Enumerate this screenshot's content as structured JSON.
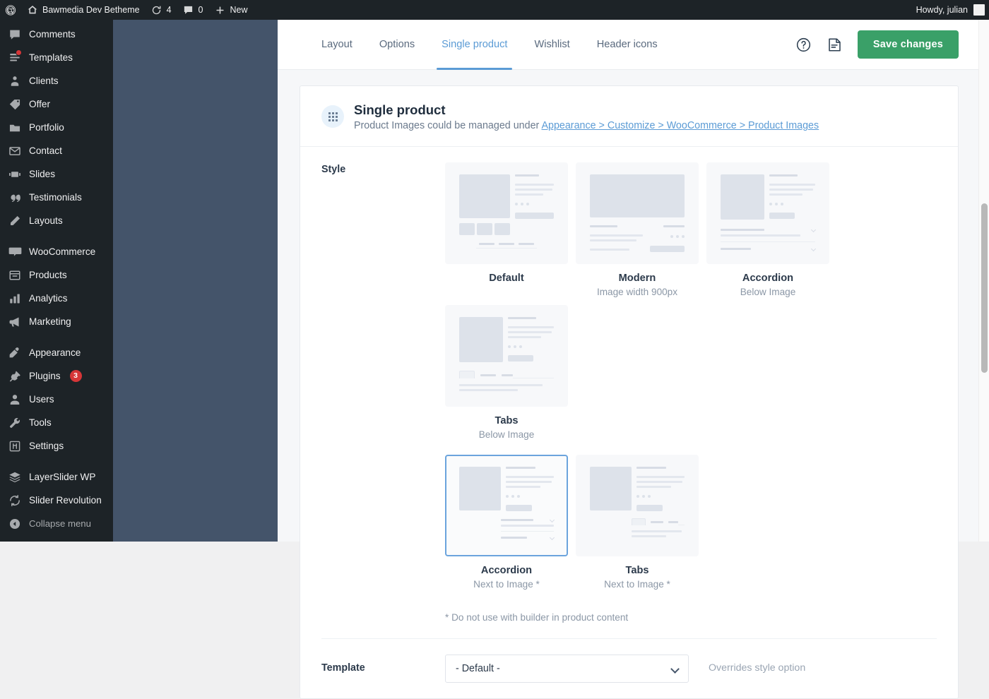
{
  "adminbar": {
    "wp_logo": "wordpress-logo",
    "site_name": "Bawmedia Dev Betheme",
    "updates_count": "4",
    "comments_count": "0",
    "new_label": "New",
    "howdy": "Howdy, julian"
  },
  "sidebar": {
    "items": [
      {
        "label": "Comments",
        "icon": "comments-icon",
        "badge": "",
        "dot": false
      },
      {
        "label": "Templates",
        "icon": "templates-icon",
        "badge": "",
        "dot": true
      },
      {
        "label": "Clients",
        "icon": "clients-icon",
        "badge": "",
        "dot": false
      },
      {
        "label": "Offer",
        "icon": "offer-icon",
        "badge": "",
        "dot": false
      },
      {
        "label": "Portfolio",
        "icon": "portfolio-icon",
        "badge": "",
        "dot": false
      },
      {
        "label": "Contact",
        "icon": "contact-icon",
        "badge": "",
        "dot": false
      },
      {
        "label": "Slides",
        "icon": "slides-icon",
        "badge": "",
        "dot": false
      },
      {
        "label": "Testimonials",
        "icon": "testimonials-icon",
        "badge": "",
        "dot": false
      },
      {
        "label": "Layouts",
        "icon": "layouts-icon",
        "badge": "",
        "dot": false
      },
      {
        "separator": true
      },
      {
        "label": "WooCommerce",
        "icon": "woocommerce-icon",
        "badge": "",
        "dot": false
      },
      {
        "label": "Products",
        "icon": "products-icon",
        "badge": "",
        "dot": false
      },
      {
        "label": "Analytics",
        "icon": "analytics-icon",
        "badge": "",
        "dot": false
      },
      {
        "label": "Marketing",
        "icon": "marketing-icon",
        "badge": "",
        "dot": false
      },
      {
        "separator": true
      },
      {
        "label": "Appearance",
        "icon": "appearance-icon",
        "badge": "",
        "dot": false
      },
      {
        "label": "Plugins",
        "icon": "plugins-icon",
        "badge": "3",
        "dot": false
      },
      {
        "label": "Users",
        "icon": "users-icon",
        "badge": "",
        "dot": false
      },
      {
        "label": "Tools",
        "icon": "tools-icon",
        "badge": "",
        "dot": false
      },
      {
        "label": "Settings",
        "icon": "settings-icon",
        "badge": "",
        "dot": false
      },
      {
        "separator": true
      },
      {
        "label": "LayerSlider WP",
        "icon": "layerslider-icon",
        "badge": "",
        "dot": false
      },
      {
        "label": "Slider Revolution",
        "icon": "slider-revolution-icon",
        "badge": "",
        "dot": false
      },
      {
        "label": "Collapse menu",
        "icon": "collapse-icon",
        "badge": "",
        "dot": false,
        "muted": true
      }
    ]
  },
  "tabs": [
    {
      "label": "Layout",
      "active": false
    },
    {
      "label": "Options",
      "active": false
    },
    {
      "label": "Single product",
      "active": true
    },
    {
      "label": "Wishlist",
      "active": false
    },
    {
      "label": "Header icons",
      "active": false
    }
  ],
  "toolbar": {
    "help_icon": "help-circle-icon",
    "notes_icon": "notes-icon",
    "save_label": "Save changes",
    "save_color": "#3aa068"
  },
  "panel": {
    "drag_handle_icon": "drag-handle-icon",
    "title": "Single product",
    "subtitle_prefix": "Product Images could be managed under ",
    "subtitle_link": "Appearance > Customize > WooCommerce > Product Images"
  },
  "style_field": {
    "label": "Style",
    "footnote": "* Do not use with builder in product content",
    "options": [
      {
        "title": "Default",
        "sub": "",
        "selected": false,
        "preview": "default"
      },
      {
        "title": "Modern",
        "sub": "Image width 900px",
        "selected": false,
        "preview": "modern"
      },
      {
        "title": "Accordion",
        "sub": "Below Image",
        "selected": false,
        "preview": "accordion-below"
      },
      {
        "title": "Tabs",
        "sub": "Below Image",
        "selected": false,
        "preview": "tabs-below"
      },
      {
        "title": "Accordion",
        "sub": "Next to Image *",
        "selected": true,
        "preview": "accordion-next"
      },
      {
        "title": "Tabs",
        "sub": "Next to Image *",
        "selected": false,
        "preview": "tabs-next"
      }
    ]
  },
  "template_field": {
    "label": "Template",
    "value": "- Default -",
    "options": [
      "- Default -"
    ],
    "hint": "Overrides style option"
  },
  "colors": {
    "accent": "#5b9bd5",
    "save_green": "#3aa068",
    "admin_dark": "#1d2327",
    "badge_red": "#d63638"
  }
}
